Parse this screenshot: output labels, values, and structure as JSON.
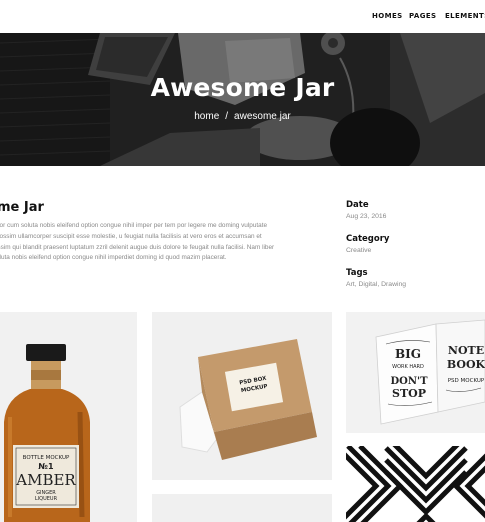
{
  "nav": {
    "items": [
      {
        "label": "HOMES"
      },
      {
        "label": "PAGES"
      },
      {
        "label": "ELEMENTS"
      }
    ]
  },
  "hero": {
    "title": "Awesome Jar",
    "breadcrumb": {
      "home": "home",
      "separator": "/",
      "current": "awesome jar"
    }
  },
  "project": {
    "title": "me Jar",
    "description": [
      "oor cum soluta nobis eleifend option congue nihil imper per tem por legere me doming vulputate",
      "possim ullamcorper suscipit esse molestie, u feugiat nulla facilisis at vero eros et accumsan et",
      "issim qui blandit praesent luptatum zzril delenit augue duis dolore te feugait nulla facilisi. Nam liber",
      "oluta nobis eleifend option congue nihil imperdiet doming id quod mazim placerat."
    ]
  },
  "meta": {
    "date": {
      "label": "Date",
      "value": "Aug 23, 2016"
    },
    "category": {
      "label": "Category",
      "value": "Creative"
    },
    "tags": {
      "label": "Tags",
      "value": "Art, Digital, Drawing"
    }
  },
  "gallery": {
    "bottle": {
      "line1": "BOTTLE MOCKUP",
      "num": "№1",
      "name": "AMBER",
      "sub1": "GINGER",
      "sub2": "LIQUEUR"
    },
    "box": {
      "line1": "PSD BOX",
      "line2": "MOCKUP"
    },
    "book": {
      "left1": "BIG",
      "left2": "WORK HARD",
      "left3": "DON'T",
      "left4": "STOP",
      "right1": "NOTE",
      "right2": "BOOK",
      "right3": "PSD MOCKUP"
    }
  },
  "colors": {
    "hero_overlay": "#2a2a2a",
    "amber": "#b8661b",
    "kraft": "#c49a6c",
    "muted_text": "#8a8a8a"
  }
}
